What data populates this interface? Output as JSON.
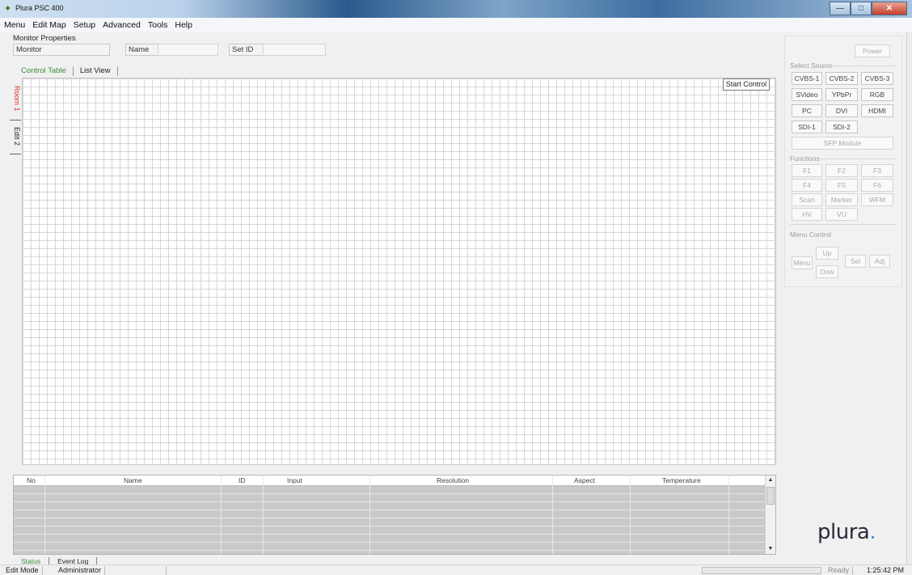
{
  "window": {
    "title": "Plura PSC 400",
    "buttons": {
      "minimize": "—",
      "maximize": "□",
      "close": "✕"
    }
  },
  "menu": [
    "Menu",
    "Edit Map",
    "Setup",
    "Advanced",
    "Tools",
    "Help"
  ],
  "monitor_properties": {
    "label": "Monitor Properties",
    "monitor_label": "Monitor",
    "name_label": "Name",
    "setid_label": "Set ID"
  },
  "tabs": [
    "Control Table",
    "List View"
  ],
  "room_tabs": [
    "Room 1",
    "Edit 2"
  ],
  "start_control": "Start Control",
  "side_panel": {
    "power": "Power",
    "select_source_label": "Select Source",
    "sources": [
      "CVBS-1",
      "CVBS-2",
      "CVBS-3",
      "SVideo",
      "YPbPr",
      "RGB",
      "PC",
      "DVI",
      "HDMI",
      "SDI-1",
      "SDI-2"
    ],
    "sfp": "SFP Module",
    "functions_label": "Functions",
    "functions": [
      "F1",
      "F2",
      "F3",
      "F4",
      "F5",
      "F6",
      "Scan",
      "Marker",
      "WFM",
      "HV",
      "VU"
    ],
    "menu_control_label": "Menu Control",
    "menu_controls": {
      "menu": "Menu",
      "up": "Up",
      "down": "Dow",
      "sel": "Sel",
      "adj": "Adj"
    }
  },
  "status_table": {
    "columns": [
      "No",
      "Name",
      "ID",
      "Input",
      "Resolution",
      "Aspect",
      "Temperature"
    ],
    "rows": []
  },
  "bottom_tabs": [
    "Status",
    "Event Log"
  ],
  "statusbar": {
    "mode": "Edit Mode",
    "user": "Administrator",
    "state": "Ready",
    "time": "1:25:42 PM"
  },
  "logo": {
    "text": "plura",
    "dot": "."
  },
  "colors": {
    "active_tab": "#3a8d3a",
    "active_room_tab": "#d9302c",
    "logo_dot": "#2e8ed8"
  }
}
